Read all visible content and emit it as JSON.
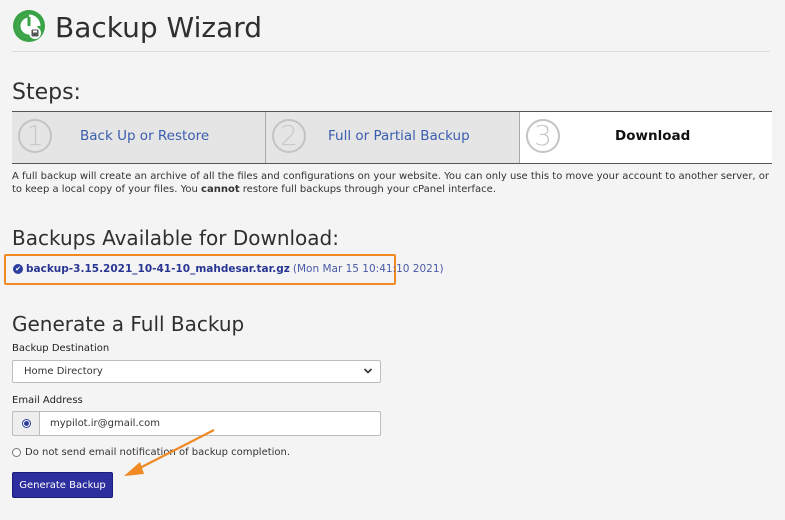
{
  "header": {
    "title": "Backup Wizard",
    "logo_icon": "backup-wizard-logo"
  },
  "steps": {
    "heading": "Steps:",
    "items": [
      {
        "number": "1",
        "label": "Back Up or Restore",
        "active": false
      },
      {
        "number": "2",
        "label": "Full or Partial Backup",
        "active": false
      },
      {
        "number": "3",
        "label": "Download",
        "active": true
      }
    ]
  },
  "description": {
    "part1": "A full backup will create an archive of all the files and configurations on your website. You can only use this to move your account to another server, or to keep a local copy of your files. You ",
    "emphasis": "cannot",
    "part2": " restore full backups through your cPanel interface."
  },
  "available": {
    "heading": "Backups Available for Download:",
    "items": [
      {
        "filename": "backup-3.15.2021_10-41-10_mahdesar.tar.gz",
        "date": "(Mon Mar 15 10:41:10 2021)"
      }
    ]
  },
  "generate": {
    "heading": "Generate a Full Backup",
    "destination_label": "Backup Destination",
    "destination_value": "Home Directory",
    "email_label": "Email Address",
    "email_value": "mypilot.ir@gmail.com",
    "no_notify_label": "Do not send email notification of backup completion.",
    "button_label": "Generate Backup"
  },
  "colors": {
    "accent": "#2d2f9e",
    "link": "#3a5dae",
    "highlight": "#ef8a25",
    "logo_green": "#3aa345"
  }
}
